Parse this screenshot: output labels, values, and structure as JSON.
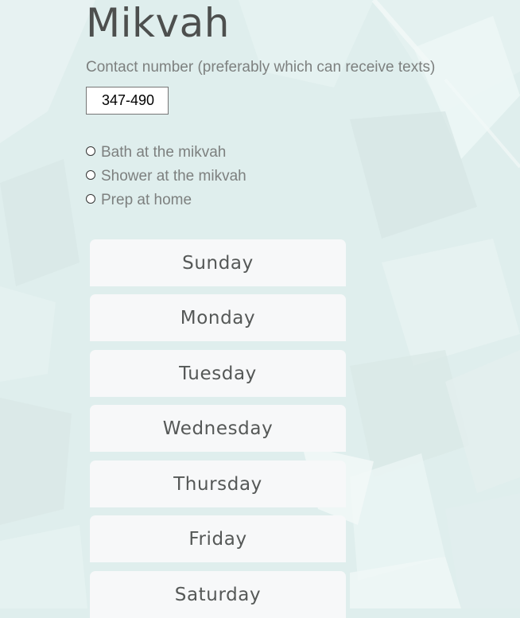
{
  "page": {
    "title": "Mikvah",
    "contact_label": "Contact number (preferably which can receive texts)",
    "phone_value": "347-490"
  },
  "options": [
    {
      "label": "Bath at the mikvah",
      "selected": false
    },
    {
      "label": "Shower at the mikvah",
      "selected": false
    },
    {
      "label": "Prep at home",
      "selected": false
    }
  ],
  "days": [
    "Sunday",
    "Monday",
    "Tuesday",
    "Wednesday",
    "Thursday",
    "Friday",
    "Saturday"
  ],
  "colors": {
    "background": "#dfeeed",
    "title": "#4d4f4e",
    "label": "#7d807f",
    "day_button_bg": "#f7f8f9",
    "day_button_text": "#555857"
  }
}
